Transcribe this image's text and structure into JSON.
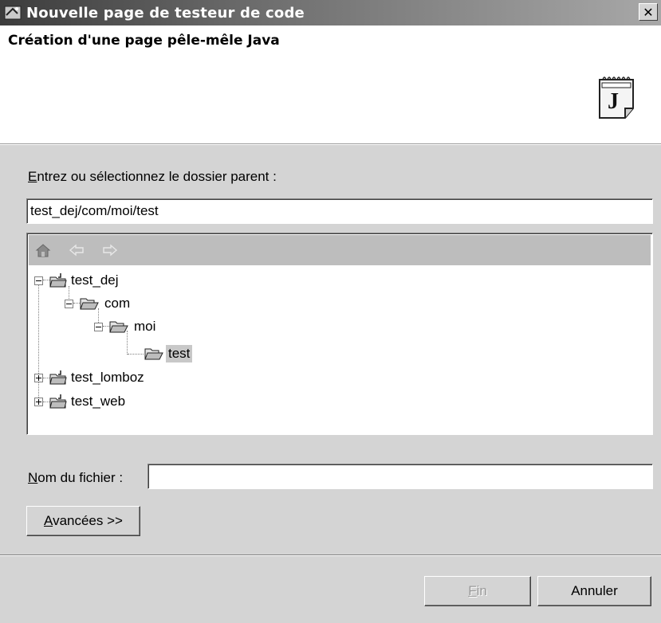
{
  "window": {
    "title": "Nouvelle page de testeur de code",
    "close_label": "✕",
    "app_icon": "wizard-icon"
  },
  "header": {
    "heading": "Création d'une page pêle-mêle Java",
    "icon": "java-scrapbook-icon"
  },
  "form": {
    "parent_folder": {
      "label_mnemonic": "E",
      "label_rest": "ntrez ou sélectionnez le dossier parent :",
      "value": "test_dej/com/moi/test"
    },
    "file_name": {
      "label_mnemonic": "N",
      "label_rest": "om du fichier :",
      "value": ""
    },
    "advanced_button": {
      "mnemonic": "A",
      "rest": "vancées >>"
    }
  },
  "tree": {
    "toolbar": [
      "home-icon",
      "back-arrow-icon",
      "forward-arrow-icon"
    ],
    "nodes": [
      {
        "label": "test_dej",
        "type": "project",
        "expanded": true,
        "depth": 0
      },
      {
        "label": "com",
        "type": "folder",
        "expanded": true,
        "depth": 1
      },
      {
        "label": "moi",
        "type": "folder",
        "expanded": true,
        "depth": 2
      },
      {
        "label": "test",
        "type": "folder",
        "expanded": false,
        "depth": 3,
        "selected": true
      },
      {
        "label": "test_lomboz",
        "type": "project",
        "expanded": false,
        "depth": 0
      },
      {
        "label": "test_web",
        "type": "project",
        "expanded": false,
        "depth": 0
      }
    ]
  },
  "footer": {
    "finish_mnemonic": "F",
    "finish_rest": "in",
    "finish_enabled": false,
    "cancel": "Annuler"
  }
}
